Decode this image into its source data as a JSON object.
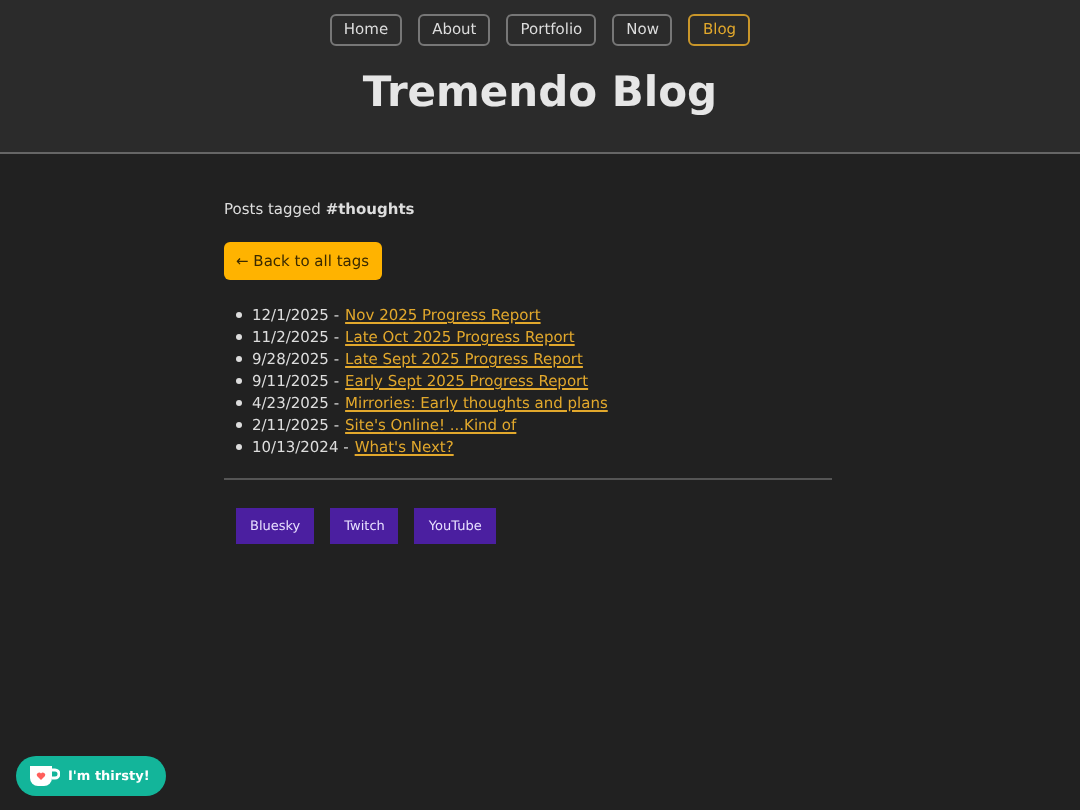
{
  "nav": [
    {
      "label": "Home",
      "selected": false
    },
    {
      "label": "About",
      "selected": false
    },
    {
      "label": "Portfolio",
      "selected": false
    },
    {
      "label": "Now",
      "selected": false
    },
    {
      "label": "Blog",
      "selected": true
    }
  ],
  "title": "Tremendo Blog",
  "heading": "Posts tagged **#thoughts**",
  "back_button": "← Back to all tags",
  "posts": [
    {
      "date": "12/1/2025 -",
      "title": "Nov 2025 Progress Report"
    },
    {
      "date": "11/2/2025 -",
      "title": "Late Oct 2025 Progress Report"
    },
    {
      "date": "9/28/2025 -",
      "title": "Late Sept 2025 Progress Report"
    },
    {
      "date": "9/11/2025 -",
      "title": "Early Sept 2025 Progress Report"
    },
    {
      "date": "4/23/2025 -",
      "title": "Mirrories: Early thoughts and plans"
    },
    {
      "date": "2/11/2025 -",
      "title": "Site's Online! ...Kind of"
    },
    {
      "date": "10/13/2024 -",
      "title": "What's Next?"
    }
  ],
  "social_links": [
    "Bluesky",
    "Twitch",
    "YouTube"
  ],
  "support_button": "I'm thirsty!"
}
